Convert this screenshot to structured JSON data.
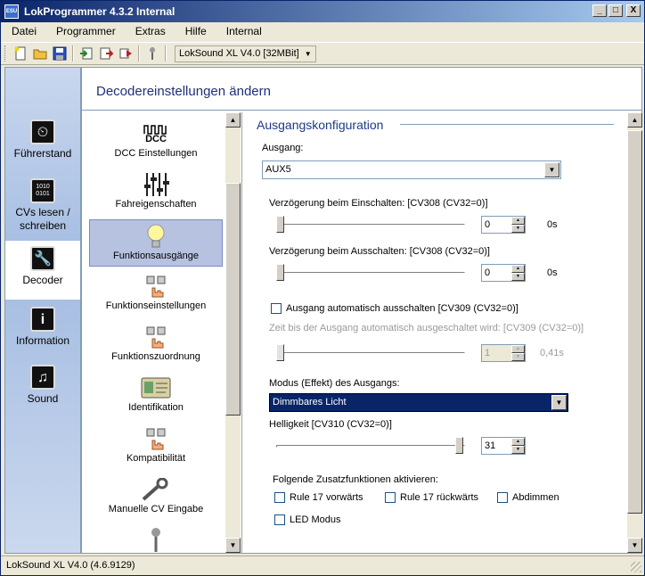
{
  "window": {
    "title": "LokProgrammer 4.3.2 Internal",
    "logo_text": "ESU",
    "buttons": {
      "minimize": "_",
      "maximize": "□",
      "close": "X"
    }
  },
  "menu": [
    "Datei",
    "Programmer",
    "Extras",
    "Hilfe",
    "Internal"
  ],
  "toolbar": {
    "icons": [
      "new-file-icon",
      "open-folder-icon",
      "save-icon",
      "import-icon",
      "export-icon",
      "run-icon",
      "tool-icon"
    ],
    "decoder_select": "LokSound XL V4.0 [32MBit]"
  },
  "leftnav": {
    "items": [
      {
        "icon": "cab-icon",
        "label": "Führerstand"
      },
      {
        "icon": "binary-icon",
        "label": "CVs lesen / schreiben"
      },
      {
        "icon": "wrench-icon",
        "label": "Decoder"
      },
      {
        "icon": "info-icon",
        "label": "Information"
      },
      {
        "icon": "music-note-icon",
        "label": "Sound"
      }
    ],
    "active": "Decoder"
  },
  "main": {
    "title": "Decodereinstellungen ändern"
  },
  "funclist": {
    "items": [
      {
        "icon": "dcc-icon",
        "icon_text": "DCC",
        "label": "DCC Einstellungen"
      },
      {
        "icon": "slider-bars-icon",
        "label": "Fahreigenschaften"
      },
      {
        "icon": "lightbulb-icon",
        "label": "Funktionsausgänge"
      },
      {
        "icon": "hand-buttons-icon",
        "label": "Funktionseinstellungen"
      },
      {
        "icon": "hand-buttons-icon",
        "label": "Funktionszuordnung"
      },
      {
        "icon": "id-card-icon",
        "label": "Identifikation"
      },
      {
        "icon": "hand-buttons-icon",
        "label": "Kompatibilität"
      },
      {
        "icon": "wrench-icon",
        "label": "Manuelle CV Eingabe"
      }
    ],
    "selected": "Funktionsausgänge"
  },
  "settings": {
    "group_title": "Ausgangskonfiguration",
    "ausgang_label": "Ausgang:",
    "ausgang_value": "AUX5",
    "ein_label": "Verzögerung beim Einschalten: [CV308 (CV32=0)]",
    "ein_value": "0",
    "ein_unit": "0s",
    "aus_label": "Verzögerung beim Ausschalten: [CV308 (CV32=0)]",
    "aus_value": "0",
    "aus_unit": "0s",
    "auto_off_label": "Ausgang automatisch ausschalten [CV309 (CV32=0)]",
    "auto_off_checked": false,
    "zeit_label": "Zeit bis der Ausgang automatisch ausgeschaltet wird: [CV309 (CV32=0)]",
    "zeit_value": "1",
    "zeit_unit": "0,41s",
    "modus_label": "Modus (Effekt) des Ausgangs:",
    "modus_value": "Dimmbares Licht",
    "hell_label": "Helligkeit [CV310 (CV32=0)]",
    "hell_value": "31",
    "zusatz_label": "Folgende Zusatzfunktionen aktivieren:",
    "zusatz": [
      {
        "label": "Rule 17 vorwärts",
        "checked": false
      },
      {
        "label": "Rule 17 rückwärts",
        "checked": false
      },
      {
        "label": "Abdimmen",
        "checked": false
      },
      {
        "label": "LED Modus",
        "checked": false
      }
    ]
  },
  "status": "LokSound XL V4.0 (4.6.9129)"
}
